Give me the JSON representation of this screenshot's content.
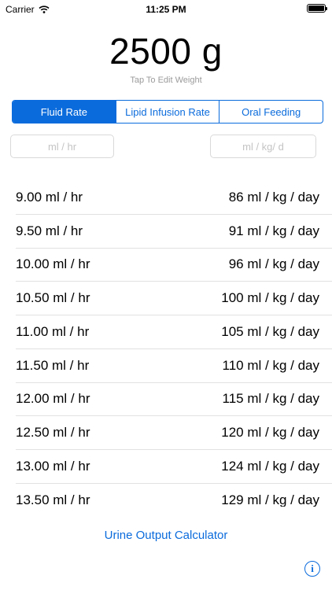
{
  "status_bar": {
    "carrier": "Carrier",
    "time": "11:25 PM"
  },
  "weight": {
    "value": "2500 g",
    "hint": "Tap To Edit Weight"
  },
  "tabs": [
    {
      "label": "Fluid Rate",
      "selected": true
    },
    {
      "label": "Lipid Infusion Rate",
      "selected": false
    },
    {
      "label": "Oral Feeding",
      "selected": false
    }
  ],
  "inputs": {
    "rate_placeholder": "ml / hr",
    "per_kg_placeholder": "ml / kg/ d"
  },
  "rows": [
    {
      "rate": "9.00 ml / hr",
      "per_kg": "86 ml / kg / day"
    },
    {
      "rate": "9.50 ml / hr",
      "per_kg": "91 ml / kg / day"
    },
    {
      "rate": "10.00 ml / hr",
      "per_kg": "96 ml / kg / day"
    },
    {
      "rate": "10.50 ml / hr",
      "per_kg": "100 ml / kg / day"
    },
    {
      "rate": "11.00 ml / hr",
      "per_kg": "105 ml / kg / day"
    },
    {
      "rate": "11.50 ml / hr",
      "per_kg": "110 ml / kg / day"
    },
    {
      "rate": "12.00 ml / hr",
      "per_kg": "115 ml / kg / day"
    },
    {
      "rate": "12.50 ml / hr",
      "per_kg": "120 ml / kg / day"
    },
    {
      "rate": "13.00 ml / hr",
      "per_kg": "124 ml / kg / day"
    },
    {
      "rate": "13.50 ml / hr",
      "per_kg": "129 ml / kg / day"
    }
  ],
  "footer": {
    "link": "Urine Output Calculator",
    "info_icon": "info-icon"
  },
  "colors": {
    "accent": "#0a6bdc",
    "hint": "#9b9b9b",
    "separator": "#e1e1e1"
  }
}
